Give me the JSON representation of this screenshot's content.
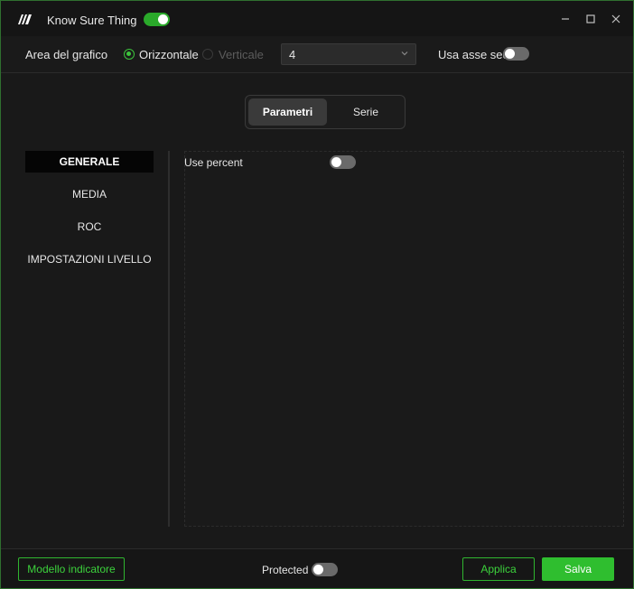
{
  "window": {
    "title": "Know Sure Thing",
    "title_toggle_on": true,
    "logo_icon": "app-logo-icon",
    "controls": [
      "minimize-icon",
      "maximize-icon",
      "close-icon"
    ]
  },
  "options": {
    "area_label": "Area del grafico",
    "radio_horizontal": "Orizzontale",
    "radio_vertical": "Verticale",
    "selected_radio": "Orizzontale",
    "select_value": "4",
    "secondary_axis_label": "Usa asse sec.",
    "secondary_axis_on": false
  },
  "tabs": {
    "params": "Parametri",
    "series": "Serie",
    "active": "Parametri"
  },
  "sidebar": {
    "items": [
      {
        "label": "GENERALE",
        "active": true
      },
      {
        "label": "MEDIA",
        "active": false
      },
      {
        "label": "ROC",
        "active": false
      },
      {
        "label": "IMPOSTAZIONI LIVELLO",
        "active": false
      }
    ]
  },
  "params": {
    "use_percent_label": "Use percent",
    "use_percent_on": false
  },
  "footer": {
    "model_button": "Modello indicatore",
    "protected_label": "Protected",
    "protected_on": false,
    "apply_button": "Applica",
    "save_button": "Salva"
  },
  "colors": {
    "accent": "#2fbe2f",
    "background": "#191919",
    "border": "#2f6f2f"
  }
}
